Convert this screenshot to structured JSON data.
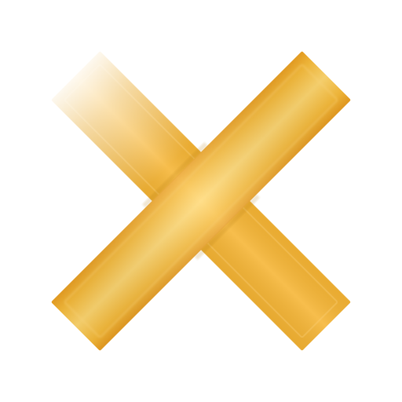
{
  "icon": {
    "name": "close-icon",
    "colors": {
      "bar_main": "#f7b733",
      "bar_edge": "#e8a21f",
      "bar_highlight": "#ffd36a",
      "bar_fade": "#ffffff"
    }
  }
}
